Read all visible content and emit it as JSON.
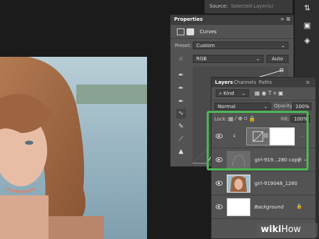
{
  "topbar": {
    "source_label": "Source:",
    "source_value": "Selected Layer(s)"
  },
  "properties": {
    "title": "Properties",
    "adjustment_name": "Curves",
    "preset_label": "Preset:",
    "preset_value": "Custom",
    "channel_value": "RGB",
    "auto_label": "Auto"
  },
  "layers_panel": {
    "tabs": [
      "Layers",
      "Channels",
      "Paths"
    ],
    "filter_value": "Kind",
    "blend_mode": "Normal",
    "opacity_label": "Opacity:",
    "opacity_value": "100%",
    "lock_label": "Lock:",
    "fill_label": "Fill:",
    "fill_value": "100%",
    "layers": [
      {
        "name": ""
      },
      {
        "name": "girl-919...280 copy"
      },
      {
        "name": "girl-919048_1280"
      },
      {
        "name": "Background"
      }
    ]
  },
  "watermark": {
    "text_bold": "wiki",
    "text_light": "How"
  }
}
